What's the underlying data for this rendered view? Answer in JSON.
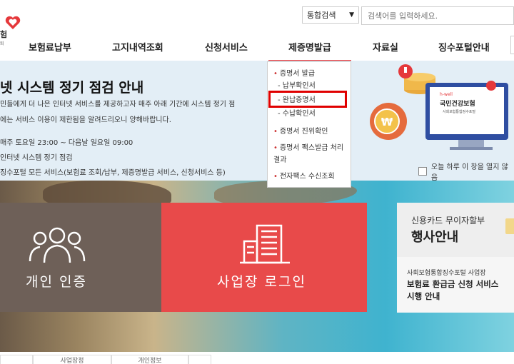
{
  "logo": {
    "text": "험",
    "sub": "퇴"
  },
  "search": {
    "scope": "통합검색",
    "placeholder": "검색어를 입력하세요."
  },
  "nav": {
    "items": [
      "보험료납부",
      "고지내역조회",
      "신청서비스",
      "제증명발급",
      "자료실",
      "징수포털안내"
    ]
  },
  "banner": {
    "title": "넷 시스템 정기 점검 안내",
    "lines": [
      "민들에게 더 나은 인터넷 서비스를 제공하고자 매주 아래 기간에 시스템 정기 점",
      "에는 서비스 이용이 제한됨을 알려드리오니 양해바랍니다.",
      "매주 토요일 23:00 ~ 다음날 일요일 09:00",
      "인터넷 시스템 정기 점검",
      "징수포털 모든 서비스(보험료 조회/납부, 제증명발급 서비스, 신청서비스 등)"
    ],
    "hide_today": "오늘 하루 이 창을 열지 않음",
    "illus_logo_brand": "h-well",
    "illus_logo_title": "국민건강보험",
    "illus_logo_sub": "사회보험통합징수포털",
    "coin_symbol": "₩"
  },
  "dropdown": {
    "items": [
      {
        "label": "증명서 발급",
        "sub": false
      },
      {
        "label": "- 납부확인서",
        "sub": true
      },
      {
        "label": "- 완납증명서",
        "sub": true
      },
      {
        "label": "- 수납확인서",
        "sub": true
      },
      {
        "label": "증명서 진위확인",
        "sub": false
      },
      {
        "label": "증명서 팩스발급 처리",
        "sub": false
      },
      {
        "label": "결과",
        "sub": false
      },
      {
        "label": "전자팩스 수신조회",
        "sub": false
      }
    ]
  },
  "tiles": {
    "personal": "개인 인증",
    "business": "사업장 로그인"
  },
  "side": {
    "card1_line1": "신용카드 무이자할부",
    "card1_line2": "행사안내",
    "card2_line1": "사회보험통합징수포털 사업장",
    "card2_line2": "보험료 환급금 신청 서비스",
    "card2_line3": "시행 안내"
  },
  "bottom_tabs": [
    "",
    "사업장정",
    "개인정보",
    ""
  ],
  "colors": {
    "accent": "#e5383b",
    "personal_tile": "#6e6058",
    "business_tile": "#e84a4a",
    "highlight": "#e00000"
  }
}
